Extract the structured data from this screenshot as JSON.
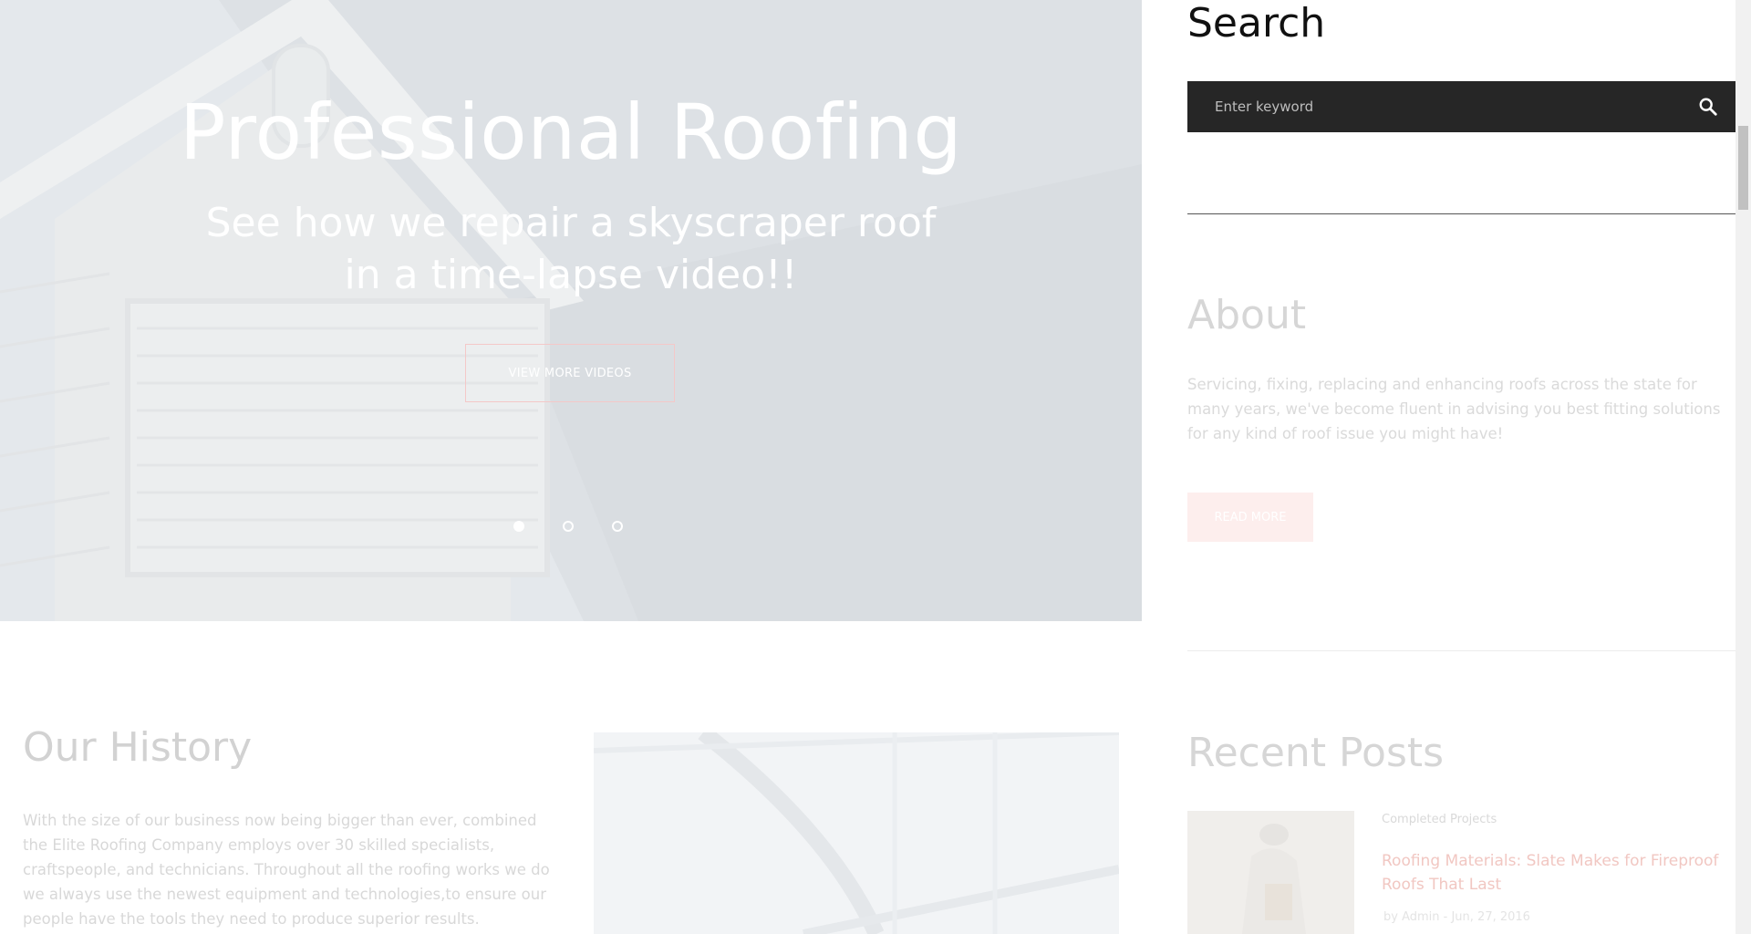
{
  "hero": {
    "title": "Professional Roofing",
    "subtitle": "See how we repair a skyscraper roof in a time-lapse video!!",
    "button_label": "VIEW MORE VIDEOS",
    "slides": 3,
    "active_slide": 1
  },
  "search": {
    "heading": "Search",
    "placeholder": "Enter keyword",
    "icon": "search-icon"
  },
  "about": {
    "heading": "About",
    "text": "Servicing, fixing, replacing and enhancing roofs across the state for many years, we've become fluent in advising you best fitting solutions for any kind of roof issue you might have!",
    "button_label": "READ MORE"
  },
  "recent_posts": {
    "heading": "Recent Posts",
    "items": [
      {
        "category": "Completed Projects",
        "title": "Roofing Materials: Slate Makes for Fireproof Roofs That Last",
        "meta": "by Admin - Jun, 27, 2016"
      }
    ]
  },
  "history": {
    "heading": "Our History",
    "text": "With the size of our business now being bigger than ever, combined the Elite Roofing Company employs over 30 skilled specialists, craftspeople, and technicians. Throughout all the roofing works we do we always use the newest equipment and technologies,to ensure our people have the tools they need to produce superior results."
  },
  "colors": {
    "accent": "#f4c8c8",
    "search_bg": "#262626"
  }
}
